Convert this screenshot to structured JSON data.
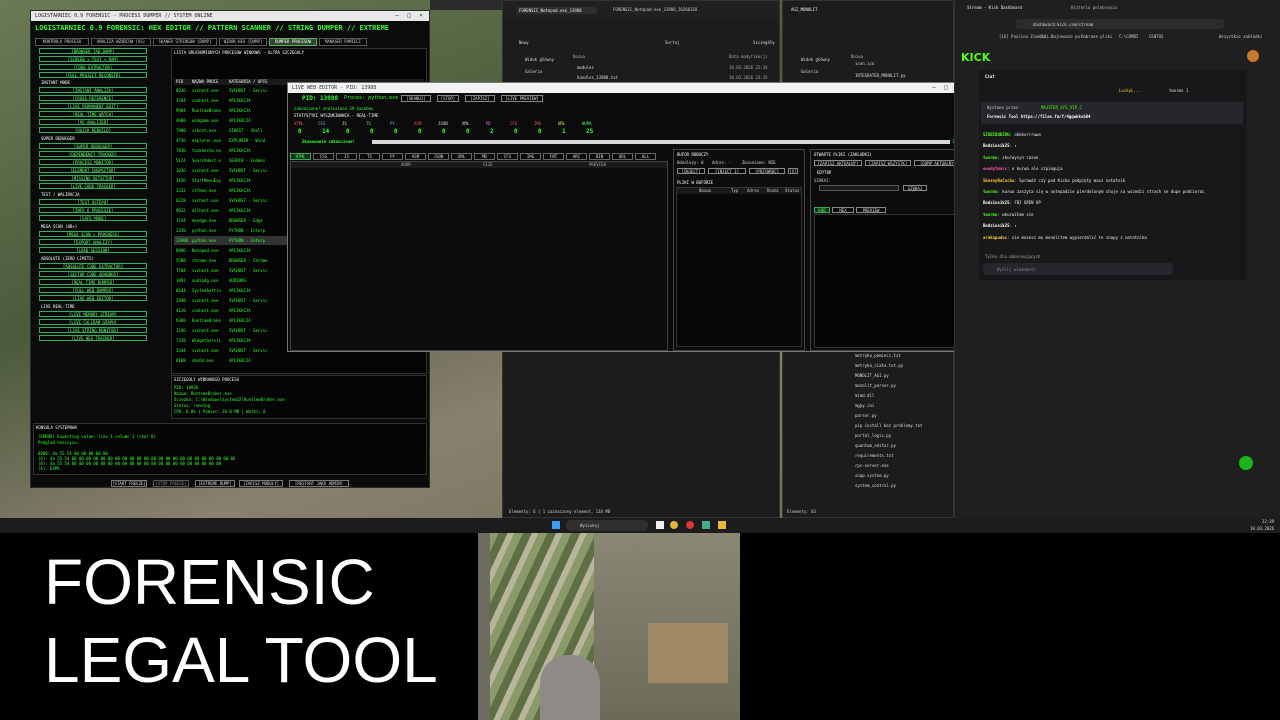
{
  "caption": {
    "line1": "FORENSIC",
    "line2": "LEGAL TOOL"
  },
  "colors": {
    "accent_green": "#33ff33",
    "kick_green": "#53fc18",
    "terminal_bg": "#0a0a0a"
  },
  "tool": {
    "title": "LOGISTARNIEC 0.9 FORENSIC: HEX EDITOR // PATTERN SCANNER // STRING DUMPER // EXTREME",
    "window_title": "LOGISTARNIEC 0.9 FORENSIC - PROCESS DUMPER // SYSTEM ONLINE",
    "tabs": [
      "KONTROLA PROCESU",
      "ANALIZA WZORCOW [AS]",
      "SKANER STRINGOW [DUMP]",
      "WIDOK HEX [DUMP]",
      "DUMPER PROCESOW",
      "MANAGER PAMIECI"
    ],
    "sidebar_top": [
      "[BROWSER TAB DUMP]",
      "[SCREEN + TEXT + RAM]",
      "[CODE EXTRACTOR]",
      "[FULL PROJECT RECONSTR]"
    ],
    "sections": [
      {
        "title": "INSTANT MODE",
        "items": [
          "[INSTANT ANALIZA]",
          "[CROSS-REFERENCE]",
          "[LIVE PERMANENT EDIT]",
          "[REAL-TIME WATCH]",
          "[PE ANALIZER]",
          "[QUICK REBUILD]"
        ]
      },
      {
        "title": "SUPER DEBUGGER",
        "items": [
          "[SUPER DEBUGGER]",
          "[DEPENDENCY TRACKER]",
          "[PROCESS MONITOR]",
          "[ELEMENT INSPECTOR]",
          "[MISSING DETECTOR]",
          "[LIVE CODE TRACKER]"
        ]
      },
      {
        "title": "TEST / WALIDACJA",
        "items": [
          "[TEST OSTEPU]",
          "[INFO O PROCESIE]",
          "[SAFE MODE]"
        ]
      },
      {
        "title": "MEGA SCAN (8B+)",
        "items": [
          "[MEGA SCAN + PROGRESS]",
          "[EXPORT ANALIZY]",
          "[LOAD SESSION]"
        ]
      },
      {
        "title": "ABSOLUTE (ZERO LIMITS)",
        "items": [
          "[ABSOLUTE CODE EXTRACTOR]",
          "[SECTOR CODE GRABBER]",
          "[REAL-TIME DUMPER]",
          "[FULL WEB DUMPER]",
          "[LIVE WEB EDITOR]"
        ]
      },
      {
        "title": "LIVE REAL-TIME",
        "items": [
          "[LIVE MEMORY STREAM]",
          "[LIVE CALLRAM GRAPH]",
          "[LIVE STRING MONITOR]",
          "[LIVE HEX TRACKER]"
        ]
      }
    ],
    "process_list_title": "LISTA URUCHOMIONYCH PROCESOW WINDOWS - ULTRA SZCZEGOLY",
    "process_columns": [
      "PID",
      "NAZWA PROCE",
      "KATEGORIA / OPIS"
    ],
    "processes": [
      [
        "8036",
        "svchost.exe",
        "SVCHOST - Servic"
      ],
      [
        "3784",
        "conhost.exe",
        "APLIKACJA"
      ],
      [
        "9904",
        "RuntimeBroke",
        "APLIKACJA"
      ],
      [
        "4680",
        "wsdgame.exe",
        "APLIKACJA"
      ],
      [
        "7980",
        "sihost.exe",
        "SIHOST - Shell"
      ],
      [
        "4756",
        "explorer.exe",
        "EXPLORER - Wind"
      ],
      [
        "7836",
        "taskhostw.ex",
        "APLIKACJA"
      ],
      [
        "5124",
        "SearchHost.e",
        "SEARCH - Indeks"
      ],
      [
        "1036",
        "svchost.exe",
        "SVCHOST - Servic"
      ],
      [
        "3456",
        "StartMenuExp",
        "APLIKACJA"
      ],
      [
        "2332",
        "ctfmon.exe",
        "APLIKACJA"
      ],
      [
        "6228",
        "svchost.exe",
        "SVCHOST - Servic"
      ],
      [
        "9012",
        "dllhost.exe",
        "APLIKACJA"
      ],
      [
        "1744",
        "msedge.exe",
        "BROWSER - Edge"
      ],
      [
        "3320",
        "python.exe",
        "PYTHON - Interp"
      ],
      [
        "13988",
        "python.exe",
        "PYTHON - Interp"
      ],
      [
        "8896",
        "Notepad.exe",
        "APLIKACJA"
      ],
      [
        "5580",
        "chrome.exe",
        "BROWSER - Chrome"
      ],
      [
        "7704",
        "svchost.exe",
        "SVCHOST - Servic"
      ],
      [
        "1892",
        "audiodg.exe",
        "AUDIODG"
      ],
      [
        "6644",
        "SystemSettin",
        "APLIKACJA"
      ],
      [
        "2840",
        "svchost.exe",
        "SVCHOST - Servic"
      ],
      [
        "4120",
        "conhost.exe",
        "APLIKACJA"
      ],
      [
        "9360",
        "RuntimeBroke",
        "APLIKACJA"
      ],
      [
        "1196",
        "svchost.exe",
        "SVCHOST - Servic"
      ],
      [
        "7320",
        "WidgetServic",
        "APLIKACJA"
      ],
      [
        "3344",
        "svchost.exe",
        "SVCHOST - Servic"
      ],
      [
        "6188",
        "obs64.exe",
        "APLIKACJA"
      ]
    ],
    "selected_header": "SZCZEGOLY WYBRANEGO PROCESU",
    "selected": [
      "PID: 10936",
      "Nazwa: RuntimeBroker.exe",
      "Sciezka: C:\\Windows\\System32\\RuntimeBroker.exe",
      "Status: running",
      "CPU: 0.0% | Pamiec: 26.0 MB | Watki: 0"
    ],
    "console_title": "KONSOLA SYSTEMOWA",
    "console_lines": [
      "[ERROR] Expecting value: line 1 column 1 (char 0)",
      "Podglad hexicycu:",
      "",
      "0000: 4a 55 54 00 00 00 00 00",
      "(4): 4a 55 54 00 00 00 00 00 00 00 00 00 00 00 00 00 00 00 00 00 00 00 00 00 00 00",
      "(8): 4a 55 54 00 00 00 00 00 00 00 00 00 00 00 00 00 00 00 00 00 00 00 00 00",
      "(4): EXPR"
    ],
    "bottom_buttons": [
      "[START FREEZE]",
      "[STOP FREEZE]",
      "[EXTREME DUMP]",
      "[ZAPISZ MODULY]",
      "[RESTART JAKO ADMIN]"
    ]
  },
  "web_editor": {
    "title": "LIVE WEB EDITOR - PID: 13988",
    "pid_label": "PID: 13988",
    "process_label": "Proces: python.exe",
    "buttons": [
      "[SKANUJ]",
      "[STOP]",
      "[ZAPISZ]",
      "[LIVE PREVIEW]"
    ],
    "status_line1": "zakonczono! znaleziono 39 zasobow",
    "stats_title": "STATYSTYKI WYSZUKIWANIA - REAL-TIME",
    "categories": [
      "HTML",
      "CSS",
      "JS",
      "TS",
      "PY",
      "ASM",
      "JSON",
      "XML",
      "MD",
      "CFG",
      "IMG",
      "URL",
      "NUMA"
    ],
    "counts": [
      "0",
      "14",
      "0",
      "0",
      "0",
      "0",
      "0",
      "0",
      "2",
      "0",
      "0",
      "1",
      "25"
    ],
    "scan_done": "Skanowanie zakonczone!",
    "progress_pct": "100%",
    "progress_value": 1.0,
    "result_tabs": [
      "HTML",
      "CSS",
      "JS",
      "TS",
      "PY",
      "ASM",
      "JSON",
      "XML",
      "MD",
      "CFG",
      "IMG",
      "FNT",
      "ARC",
      "BIN",
      "URL",
      "ALL"
    ],
    "result_columns": [
      "ADDR",
      "SIZE",
      "PREVIEW"
    ],
    "work_buffer_title": "BUFOR ROBOCZY",
    "work_buffer_fields": [
      "Odnalezy: 0",
      "Adres: -",
      "Zmienione: NIE"
    ],
    "work_buffer_buttons": [
      "[INJECT]",
      "[INJECT 1]",
      "[PRZYWROC]",
      "[X]"
    ],
    "files_title": "PLIKI W BUFORZE",
    "files_columns": [
      "Nazwa",
      "Typ",
      "Adres",
      "Rozmi",
      "Status"
    ],
    "open_files_title": "OTWARTE PLIKI (ZAKLADKI)",
    "open_files_buttons": [
      "[ZAPISZ AKTUALNY]",
      "[ZAPISZ WSZYSTK]",
      "[DUMP AKTUALNY]"
    ],
    "editor_title": "EDYTOR",
    "find_label": "SZUKAJ:",
    "find_button": "SZUKAJ",
    "editor_tabs": [
      "KOD",
      "HEX",
      "PREVIEW"
    ]
  },
  "explorer1": {
    "tabs": [
      "FORENSIC_Notepad.exe_13988",
      "FORENSIC_Notepad.exe_13988_20260318"
    ],
    "toolbar": [
      "Nowy",
      "Sortuj",
      "Widok",
      "Szczegóły"
    ],
    "nav": [
      "Widok główny",
      "Galeria"
    ],
    "columns": [
      "Nazwa",
      "Data modyfikacji"
    ],
    "files": [
      [
        "modules",
        "18.03.2026 22:34"
      ],
      [
        "handles_13988.txt",
        "18.03.2026 23:35"
      ]
    ],
    "status": "Elementy: 6  |  1 zaznaczony element, 118 MB"
  },
  "explorer2": {
    "tab": "AGI_MONOLIT",
    "nav": [
      "Widok główny",
      "Galeria"
    ],
    "column": "Nazwa",
    "files_top": [
      "icon.ico",
      "INTEGRATED_MONOLIT.py"
    ],
    "files": [
      "metryka_pamieci.txt",
      "metryka_ciała.txt.py",
      "MONOLIT_AGI.py",
      "monolit_parser.py",
      "mimd.dll",
      "mgpy.ini",
      "parser.py",
      "pip install bez problemy.txt",
      "portal_logic.py",
      "quantum_editor.py",
      "requirements.txt",
      "rpc-server.exe",
      "snap.system.py",
      "system_control.py"
    ],
    "status": "Elementy: 83"
  },
  "browser": {
    "tabs": [
      "Stream - Kick Dashboard",
      "Historia polebrania"
    ],
    "url": "dashboard.kick.com/stream",
    "bookmarks": [
      "[16] Paulina Ziemia...",
      "(14) Najnowsze po...",
      "Pobrane pliki",
      "C:\\COMBI",
      "CENTOS",
      "Wszystkie zakładki"
    ],
    "logo": "KICK",
    "chat_title": "Czat",
    "top_users": [
      "LuckyL...",
      "twormo 1"
    ],
    "pinned_label": "Wysłane przez",
    "pinned_user": "MAJSTER_SYS_VIP_C",
    "pinned_text": "Forensic Tool https://files.fm/f/4gqwkkvb84",
    "messages": [
      {
        "user": "SZUBIDUBIDU",
        "text": "okkkurrrwwa"
      },
      {
        "user": "Bodziosik25",
        "text": "✦"
      },
      {
        "user": "twormo",
        "text": "skurwysyn razon"
      },
      {
        "user": "ewadytmarc",
        "text": "o kurwa ale szpieguja"
      },
      {
        "user": "SkeznyNaCucko",
        "text": "Sprawdź czy pod Kicka podpięty masz notatnik"
      },
      {
        "user": "twormo",
        "text": "kurwa zaszyta się w notepadzie pierdolonym chuje sa wszedzi strach se dupe podcierac"
      },
      {
        "user": "Bodziosik25",
        "text": "FBI OPEN UP"
      },
      {
        "user": "twormo",
        "text": "wkurwiłem sie"
      },
      {
        "user": "Bodziosik25",
        "text": "✦"
      },
      {
        "user": "arakapudoc",
        "text": "nie mozesz mu monolitem wypierdolić te snapy z notatnika"
      }
    ],
    "chat_footer": "Tylko dla obserwujących",
    "chat_placeholder": "Wyślij wiadomość"
  },
  "taskbar": {
    "search": "Wyszukaj",
    "time": "22:39",
    "date": "18.03.2026"
  }
}
